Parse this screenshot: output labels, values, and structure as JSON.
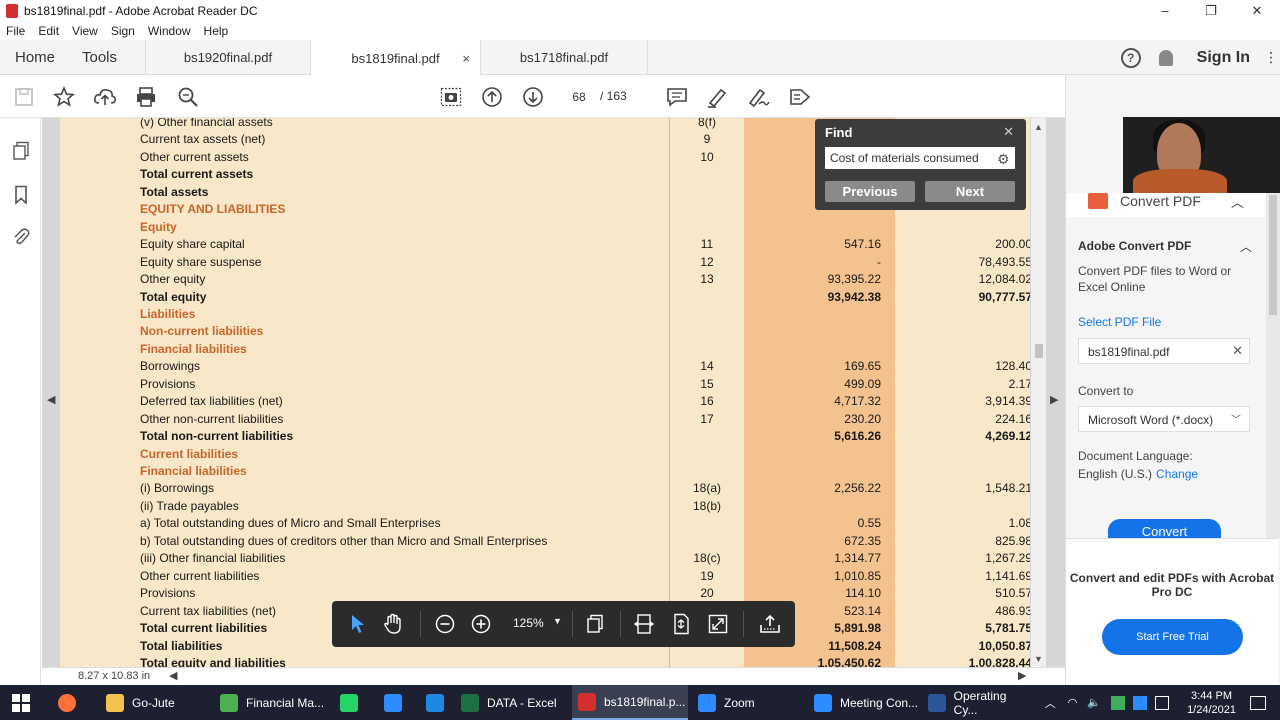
{
  "window": {
    "title": "bs1819final.pdf - Adobe Acrobat Reader DC",
    "minimize": "–",
    "restore": "❐",
    "close": "✕"
  },
  "menu": [
    "File",
    "Edit",
    "View",
    "Sign",
    "Window",
    "Help"
  ],
  "tabs": {
    "home": "Home",
    "tools": "Tools",
    "files": [
      {
        "label": "bs1920final.pdf",
        "active": false
      },
      {
        "label": "bs1819final.pdf",
        "active": true
      },
      {
        "label": "bs1718final.pdf",
        "active": false
      }
    ],
    "close": "×",
    "help": "?",
    "sign_in": "Sign In",
    "more": "⋮"
  },
  "toolbar": {
    "page_current": "68",
    "page_total": "/ 163"
  },
  "document": {
    "rows": [
      {
        "label": "(v) Other financial assets",
        "note": "8(f)",
        "cur": "",
        "prev": "",
        "style": "partial"
      },
      {
        "label": "Current tax assets (net)",
        "note": "9",
        "cur": "",
        "prev": "",
        "style": ""
      },
      {
        "label": "Other current assets",
        "note": "10",
        "cur": "",
        "prev": "",
        "style": ""
      },
      {
        "label": "Total current assets",
        "note": "",
        "cur": "",
        "prev": "",
        "style": "bold"
      },
      {
        "label": "Total assets",
        "note": "",
        "cur": "",
        "prev": "",
        "style": "bold"
      },
      {
        "label": "EQUITY AND LIABILITIES",
        "note": "",
        "cur": "",
        "prev": "",
        "style": "orange"
      },
      {
        "label": "Equity",
        "note": "",
        "cur": "",
        "prev": "",
        "style": "orange"
      },
      {
        "label": "Equity share capital",
        "note": "11",
        "cur": "547.16",
        "prev": "200.00",
        "style": ""
      },
      {
        "label": "Equity share suspense",
        "note": "12",
        "cur": "-",
        "prev": "78,493.55",
        "style": ""
      },
      {
        "label": "Other equity",
        "note": "13",
        "cur": "93,395.22",
        "prev": "12,084.02",
        "style": ""
      },
      {
        "label": "Total equity",
        "note": "",
        "cur": "93,942.38",
        "prev": "90,777.57",
        "style": "bold"
      },
      {
        "label": "Liabilities",
        "note": "",
        "cur": "",
        "prev": "",
        "style": "orange"
      },
      {
        "label": "Non-current liabilities",
        "note": "",
        "cur": "",
        "prev": "",
        "style": "orange"
      },
      {
        "label": "Financial liabilities",
        "note": "",
        "cur": "",
        "prev": "",
        "style": "orange"
      },
      {
        "label": "Borrowings",
        "note": "14",
        "cur": "169.65",
        "prev": "128.40",
        "style": ""
      },
      {
        "label": "Provisions",
        "note": "15",
        "cur": "499.09",
        "prev": "2.17",
        "style": ""
      },
      {
        "label": "Deferred tax liabilities (net)",
        "note": "16",
        "cur": "4,717.32",
        "prev": "3,914.39",
        "style": ""
      },
      {
        "label": "Other non-current liabilities",
        "note": "17",
        "cur": "230.20",
        "prev": "224.16",
        "style": ""
      },
      {
        "label": "Total non-current liabilities",
        "note": "",
        "cur": "5,616.26",
        "prev": "4,269.12",
        "style": "bold"
      },
      {
        "label": "Current liabilities",
        "note": "",
        "cur": "",
        "prev": "",
        "style": "orange"
      },
      {
        "label": "Financial liabilities",
        "note": "",
        "cur": "",
        "prev": "",
        "style": "orange"
      },
      {
        "label": "(i)  Borrowings",
        "note": "18(a)",
        "cur": "2,256.22",
        "prev": "1,548.21",
        "style": ""
      },
      {
        "label": "(ii) Trade payables",
        "note": "18(b)",
        "cur": "",
        "prev": "",
        "style": ""
      },
      {
        "label": "a)  Total outstanding dues of Micro and Small Enterprises",
        "note": "",
        "cur": "0.55",
        "prev": "1.08",
        "style": ""
      },
      {
        "label": "b)  Total outstanding dues of creditors other than Micro and Small Enterprises",
        "note": "",
        "cur": "672.35",
        "prev": "825.98",
        "style": ""
      },
      {
        "label": "(iii) Other financial liabilities",
        "note": "18(c)",
        "cur": "1,314.77",
        "prev": "1,267.29",
        "style": ""
      },
      {
        "label": "Other current liabilities",
        "note": "19",
        "cur": "1,010.85",
        "prev": "1,141.69",
        "style": ""
      },
      {
        "label": "Provisions",
        "note": "20",
        "cur": "114.10",
        "prev": "510.57",
        "style": ""
      },
      {
        "label": "Current tax liabilities (net)",
        "note": "",
        "cur": "523.14",
        "prev": "486.93",
        "style": ""
      },
      {
        "label": "Total current liabilities",
        "note": "",
        "cur": "5,891.98",
        "prev": "5,781.75",
        "style": "bold"
      },
      {
        "label": "Total liabilities",
        "note": "",
        "cur": "11,508.24",
        "prev": "10,050.87",
        "style": "bold"
      },
      {
        "label": "Total equity and liabilities",
        "note": "",
        "cur": "1,05,450.62",
        "prev": "1,00,828.44",
        "style": "bold"
      }
    ],
    "page_size": "8.27 x 10.83 in"
  },
  "find": {
    "title": "Find",
    "query": "Cost of materials consumed",
    "previous": "Previous",
    "next": "Next",
    "close": "✕"
  },
  "floating_toolbar": {
    "zoom": "125%"
  },
  "right_pane": {
    "header": "Convert PDF",
    "title": "Adobe Convert PDF",
    "description": "Convert PDF files to Word or Excel Online",
    "select_file": "Select PDF File",
    "file_name": "bs1819final.pdf",
    "convert_to_label": "Convert to",
    "convert_to_value": "Microsoft Word (*.docx)",
    "lang_label": "Document Language:",
    "lang_value": "English (U.S.)",
    "lang_change": "Change",
    "convert_button": "Convert",
    "promo": "Convert and edit PDFs with Acrobat Pro DC",
    "trial_button": "Start Free Trial"
  },
  "taskbar": {
    "items": [
      {
        "label": "Go-Jute",
        "color": "#f2c14e"
      },
      {
        "label": "Financial Ma...",
        "color": "#4caf50"
      },
      {
        "label": "",
        "color": "#25d366"
      },
      {
        "label": "",
        "color": "#2d8cff"
      },
      {
        "label": "",
        "color": "#1e88e5"
      },
      {
        "label": "DATA - Excel",
        "color": "#1d7044"
      },
      {
        "label": "bs1819final.p...",
        "color": "#d32f2f"
      },
      {
        "label": "Zoom",
        "color": "#2d8cff"
      },
      {
        "label": "Meeting Con...",
        "color": "#2d8cff"
      },
      {
        "label": "Operating Cy...",
        "color": "#2b579a"
      }
    ],
    "time": "3:44 PM",
    "date": "1/24/2021"
  }
}
